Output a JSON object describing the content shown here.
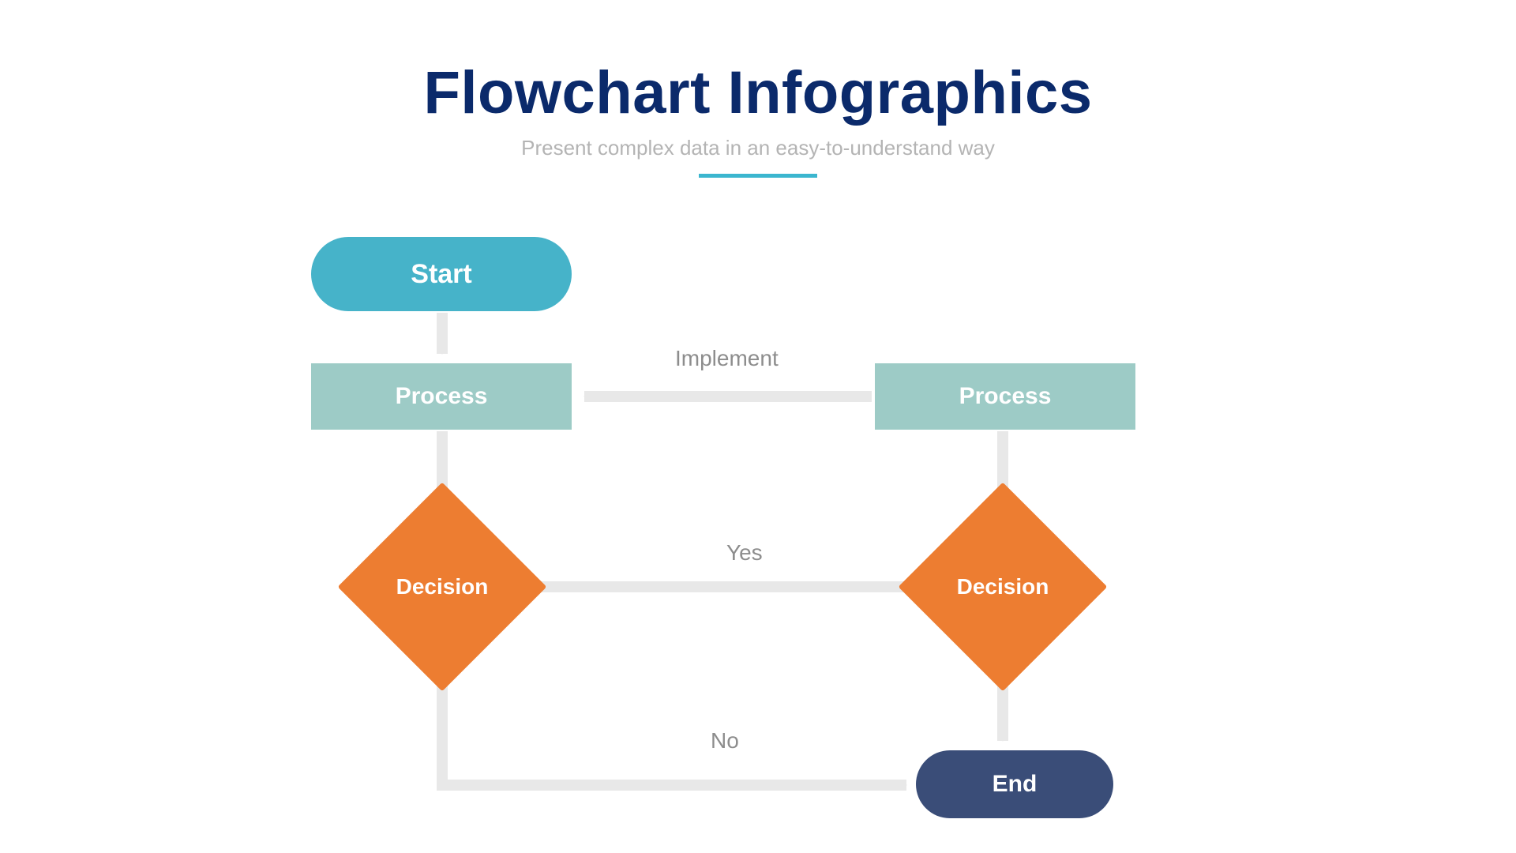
{
  "header": {
    "title": "Flowchart Infographics",
    "subtitle": "Present complex data in an easy-to-understand way"
  },
  "nodes": {
    "start": "Start",
    "process_left": "Process",
    "process_right": "Process",
    "decision_left": "Decision",
    "decision_right": "Decision",
    "end": "End"
  },
  "edges": {
    "implement": "Implement",
    "yes": "Yes",
    "no": "No"
  },
  "colors": {
    "title": "#0b2a6b",
    "accent": "#3bb6cf",
    "start": "#46b3c9",
    "process": "#9dcbc6",
    "decision": "#ed7d31",
    "end": "#3a4d78",
    "arrow": "#e8e8e8",
    "label": "#8d8d8d"
  },
  "chart_data": {
    "type": "flowchart",
    "nodes": [
      {
        "id": "start",
        "kind": "terminator",
        "label": "Start",
        "col": 0,
        "row": 0
      },
      {
        "id": "process_left",
        "kind": "process",
        "label": "Process",
        "col": 0,
        "row": 1
      },
      {
        "id": "process_right",
        "kind": "process",
        "label": "Process",
        "col": 1,
        "row": 1
      },
      {
        "id": "decision_left",
        "kind": "decision",
        "label": "Decision",
        "col": 0,
        "row": 2
      },
      {
        "id": "decision_right",
        "kind": "decision",
        "label": "Decision",
        "col": 1,
        "row": 2
      },
      {
        "id": "end",
        "kind": "terminator",
        "label": "End",
        "col": 1,
        "row": 3
      }
    ],
    "edges": [
      {
        "from": "start",
        "to": "process_left",
        "label": ""
      },
      {
        "from": "process_right",
        "to": "process_left",
        "label": "Implement"
      },
      {
        "from": "process_left",
        "to": "decision_left",
        "label": ""
      },
      {
        "from": "process_right",
        "to": "decision_right",
        "label": ""
      },
      {
        "from": "decision_left",
        "to": "decision_right",
        "label": "Yes"
      },
      {
        "from": "decision_left",
        "to": "end",
        "label": "No"
      },
      {
        "from": "decision_right",
        "to": "end",
        "label": ""
      }
    ]
  }
}
